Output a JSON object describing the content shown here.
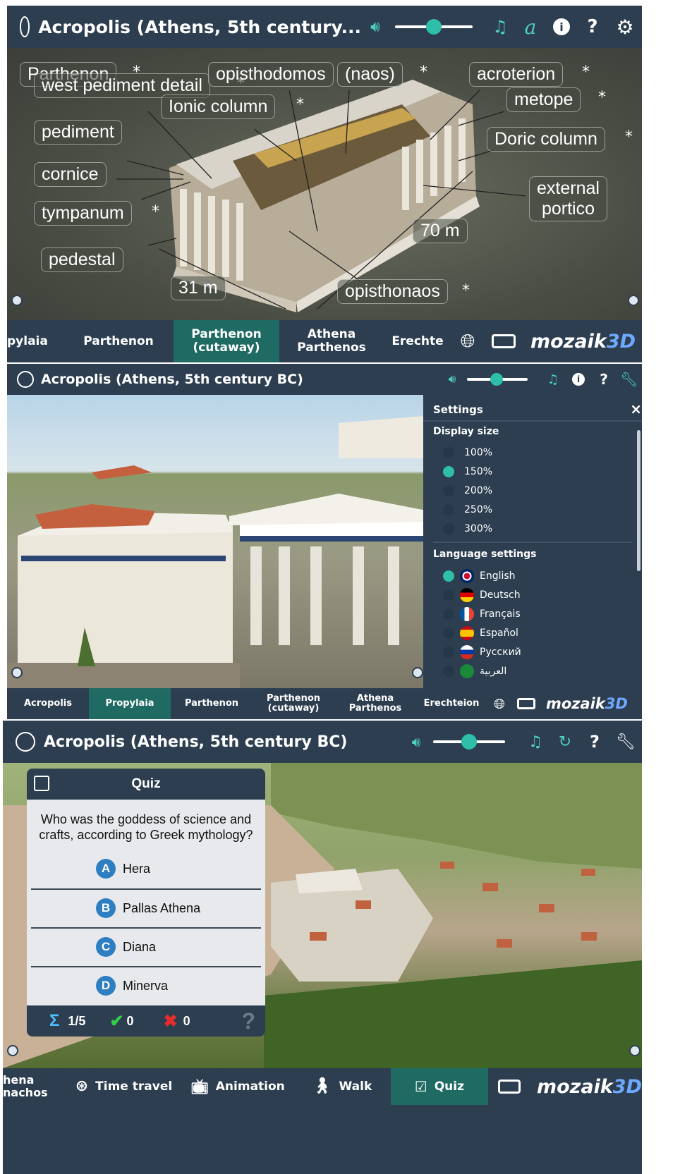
{
  "colors": {
    "bar": "#2c3e50",
    "accent": "#2fbfa8",
    "active_tab": "#1f6b63",
    "brand_3d": "#6ea8ff"
  },
  "brand": {
    "name": "mozaik",
    "suffix": "3D"
  },
  "panel1": {
    "title": "Acropolis (Athens, 5th century...",
    "labels": {
      "parthenon": "Parthenon",
      "west_pediment": "west pediment detail",
      "opisthodomos": "opisthodomos",
      "naos": "(naos)",
      "acroterion": "acroterion",
      "metope": "metope",
      "ionic": "Ionic column",
      "pediment": "pediment",
      "doric": "Doric column",
      "cornice": "cornice",
      "external_portico": "external\nportico",
      "tympanum": "tympanum",
      "dim70": "70 m",
      "pedestal": "pedestal",
      "dim31": "31 m",
      "opisthonaos": "opisthonaos"
    },
    "star": "*",
    "tabs": [
      "pylaia",
      "Parthenon",
      "Parthenon\n(cutaway)",
      "Athena\nParthenos",
      "Erechte"
    ]
  },
  "panel2": {
    "title": "Acropolis (Athens, 5th century BC)",
    "settings": {
      "title": "Settings",
      "close": "×",
      "display_size_header": "Display size",
      "sizes": [
        "100%",
        "150%",
        "200%",
        "250%",
        "300%"
      ],
      "selected_size": "150%",
      "language_header": "Language settings",
      "languages": [
        "English",
        "Deutsch",
        "Français",
        "Español",
        "Русский",
        "العربية"
      ],
      "selected_language": "English"
    },
    "tabs": [
      "Acropolis",
      "Propylaia",
      "Parthenon",
      "Parthenon\n(cutaway)",
      "Athena\nParthenos",
      "Erechteion"
    ]
  },
  "panel3": {
    "title": "Acropolis (Athens, 5th century BC)",
    "quiz": {
      "title": "Quiz",
      "question": "Who was the goddess of science and crafts, according to Greek mythology?",
      "options": [
        {
          "letter": "A",
          "text": "Hera"
        },
        {
          "letter": "B",
          "text": "Pallas Athena"
        },
        {
          "letter": "C",
          "text": "Diana"
        },
        {
          "letter": "D",
          "text": "Minerva"
        }
      ],
      "progress": "1/5",
      "correct": "0",
      "wrong": "0",
      "help": "?"
    },
    "tabs": {
      "cut": "hena\nnachos",
      "time_travel": "Time travel",
      "animation": "Animation",
      "walk": "Walk",
      "quiz": "Quiz"
    }
  }
}
